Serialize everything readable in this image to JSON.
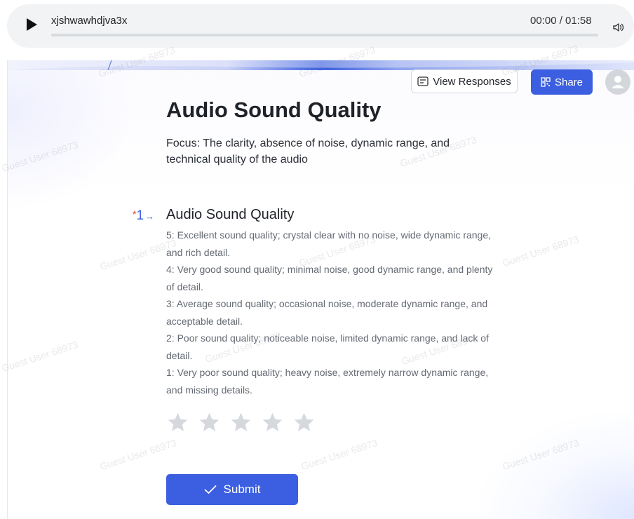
{
  "player": {
    "track_name": "xjshwawhdjva3x",
    "time_display": "00:00 / 01:58",
    "progress": 0
  },
  "toolbar": {
    "view_responses_label": "View Responses",
    "share_label": "Share"
  },
  "form": {
    "title": "Audio Sound Quality",
    "description": "Focus: The clarity, absence of noise, dynamic range, and technical quality of the audio"
  },
  "question": {
    "required_mark": "*",
    "number": "1",
    "arrow": "→",
    "title": "Audio Sound Quality",
    "criteria": [
      "5: Excellent sound quality; crystal clear with no noise, wide dynamic range, and rich detail.",
      "4: Very good sound quality; minimal noise, good dynamic range, and plenty of detail.",
      "3: Average sound quality; occasional noise, moderate dynamic range, and acceptable detail.",
      "2: Poor sound quality; noticeable noise, limited dynamic range, and lack of detail.",
      "1: Very poor sound quality; heavy noise, extremely narrow dynamic range, and missing details."
    ],
    "rating_max": 5,
    "rating_value": 0
  },
  "submit_label": "Submit",
  "watermark": "Guest User 68973",
  "colors": {
    "accent": "#3b5fe0",
    "required": "#e0452d",
    "star_empty": "#d5d8dd"
  }
}
